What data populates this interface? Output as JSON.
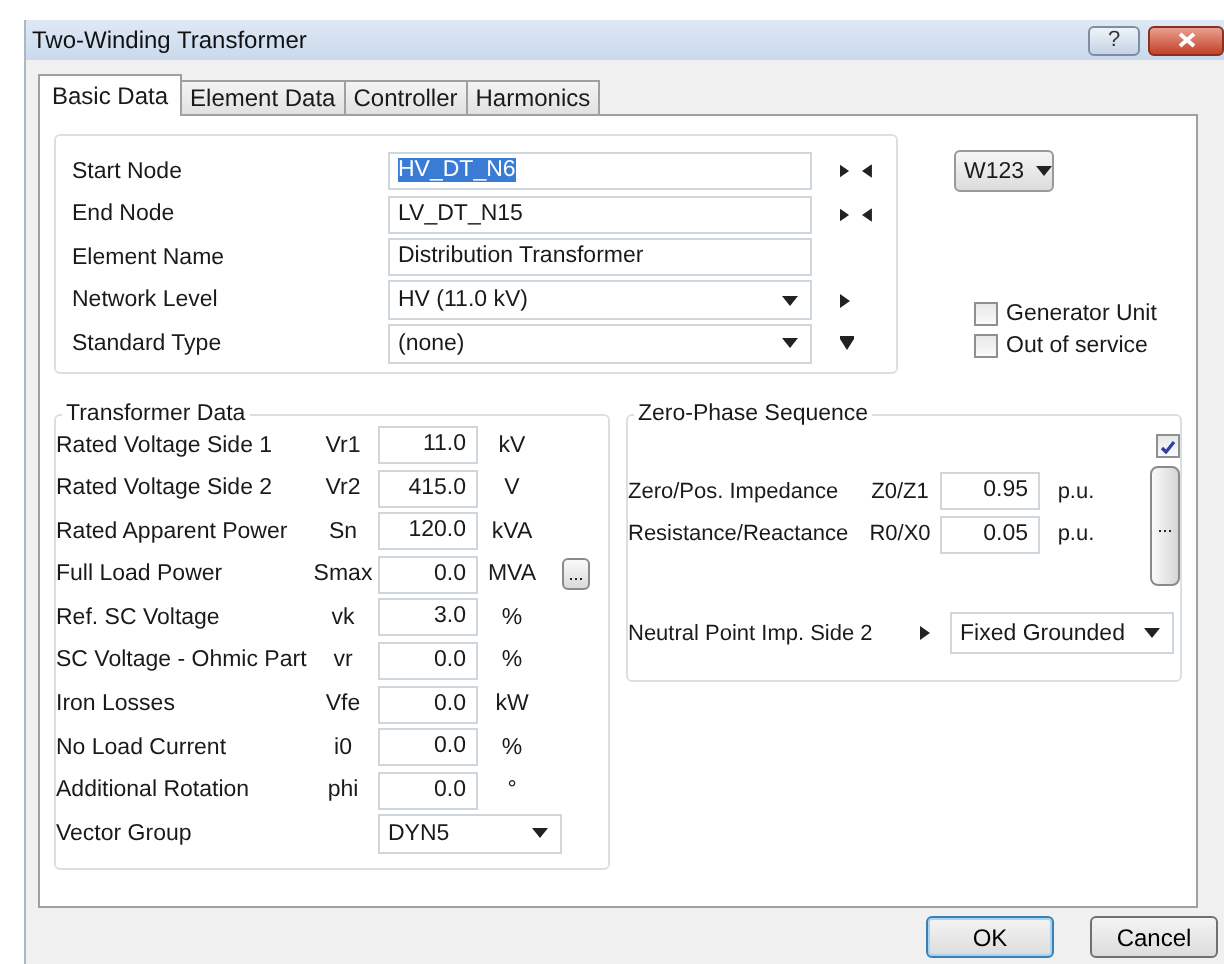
{
  "window": {
    "title": "Two-Winding Transformer",
    "help_button": "?"
  },
  "tabs": [
    {
      "label": "Basic Data",
      "selected": true
    },
    {
      "label": "Element Data",
      "selected": false
    },
    {
      "label": "Controller",
      "selected": false
    },
    {
      "label": "Harmonics",
      "selected": false
    }
  ],
  "node_fields": [
    {
      "label": "Start Node",
      "value": "HV_DT_N6",
      "kind": "text",
      "highlighted": true,
      "next_button": true,
      "back_button": true,
      "filter_button": false
    },
    {
      "label": "End Node",
      "value": "LV_DT_N15",
      "kind": "text",
      "highlighted": false,
      "next_button": true,
      "back_button": true,
      "filter_button": false
    },
    {
      "label": "Element Name",
      "value": "Distribution Transformer",
      "kind": "text",
      "highlighted": false,
      "next_button": false,
      "back_button": false,
      "filter_button": false
    },
    {
      "label": "Network Level",
      "value": "HV (11.0 kV)",
      "kind": "dropdown",
      "highlighted": false,
      "next_button": true,
      "back_button": false,
      "filter_button": false
    },
    {
      "label": "Standard Type",
      "value": "(none)",
      "kind": "dropdown",
      "highlighted": false,
      "next_button": false,
      "back_button": false,
      "filter_button": true
    }
  ],
  "variant_dropdown": "W123",
  "checkboxes": [
    {
      "label": "Generator Unit",
      "checked": false
    },
    {
      "label": "Out of service",
      "checked": false
    }
  ],
  "transformer_data": {
    "title": "Transformer Data",
    "rows": [
      {
        "label": "Rated Voltage Side 1",
        "symbol": "Vr1",
        "value": "11.0",
        "unit": "kV",
        "kind": "number"
      },
      {
        "label": "Rated Voltage Side 2",
        "symbol": "Vr2",
        "value": "415.0",
        "unit": "V",
        "kind": "number"
      },
      {
        "label": "Rated Apparent Power",
        "symbol": "Sn",
        "value": "120.0",
        "unit": "kVA",
        "kind": "number"
      },
      {
        "label": "Full Load Power",
        "symbol": "Smax",
        "value": "0.0",
        "unit": "MVA",
        "kind": "number",
        "more_button": "..."
      },
      {
        "label": "Ref. SC Voltage",
        "symbol": "vk",
        "value": "3.0",
        "unit": "%",
        "kind": "number"
      },
      {
        "label": "SC Voltage - Ohmic Part",
        "symbol": "vr",
        "value": "0.0",
        "unit": "%",
        "kind": "number"
      },
      {
        "label": "Iron Losses",
        "symbol": "Vfe",
        "value": "0.0",
        "unit": "kW",
        "kind": "number"
      },
      {
        "label": "No Load Current",
        "symbol": "i0",
        "value": "0.0",
        "unit": "%",
        "kind": "number"
      },
      {
        "label": "Additional Rotation",
        "symbol": "phi",
        "value": "0.0",
        "unit": "°",
        "kind": "number"
      },
      {
        "label": "Vector Group",
        "value": "DYN5",
        "kind": "dropdown"
      }
    ]
  },
  "zero_phase": {
    "title": "Zero-Phase Sequence",
    "checked": true,
    "more_button": "...",
    "rows": [
      {
        "label": "Zero/Pos. Impedance",
        "symbol": "Z0/Z1",
        "value": "0.95",
        "unit": "p.u."
      },
      {
        "label": "Resistance/Reactance",
        "symbol": "R0/X0",
        "value": "0.05",
        "unit": "p.u."
      }
    ],
    "neutral": {
      "label": "Neutral Point Imp. Side 2",
      "value": "Fixed Grounded"
    }
  },
  "buttons": [
    {
      "label": "OK",
      "default": true
    },
    {
      "label": "Cancel",
      "default": false
    }
  ]
}
